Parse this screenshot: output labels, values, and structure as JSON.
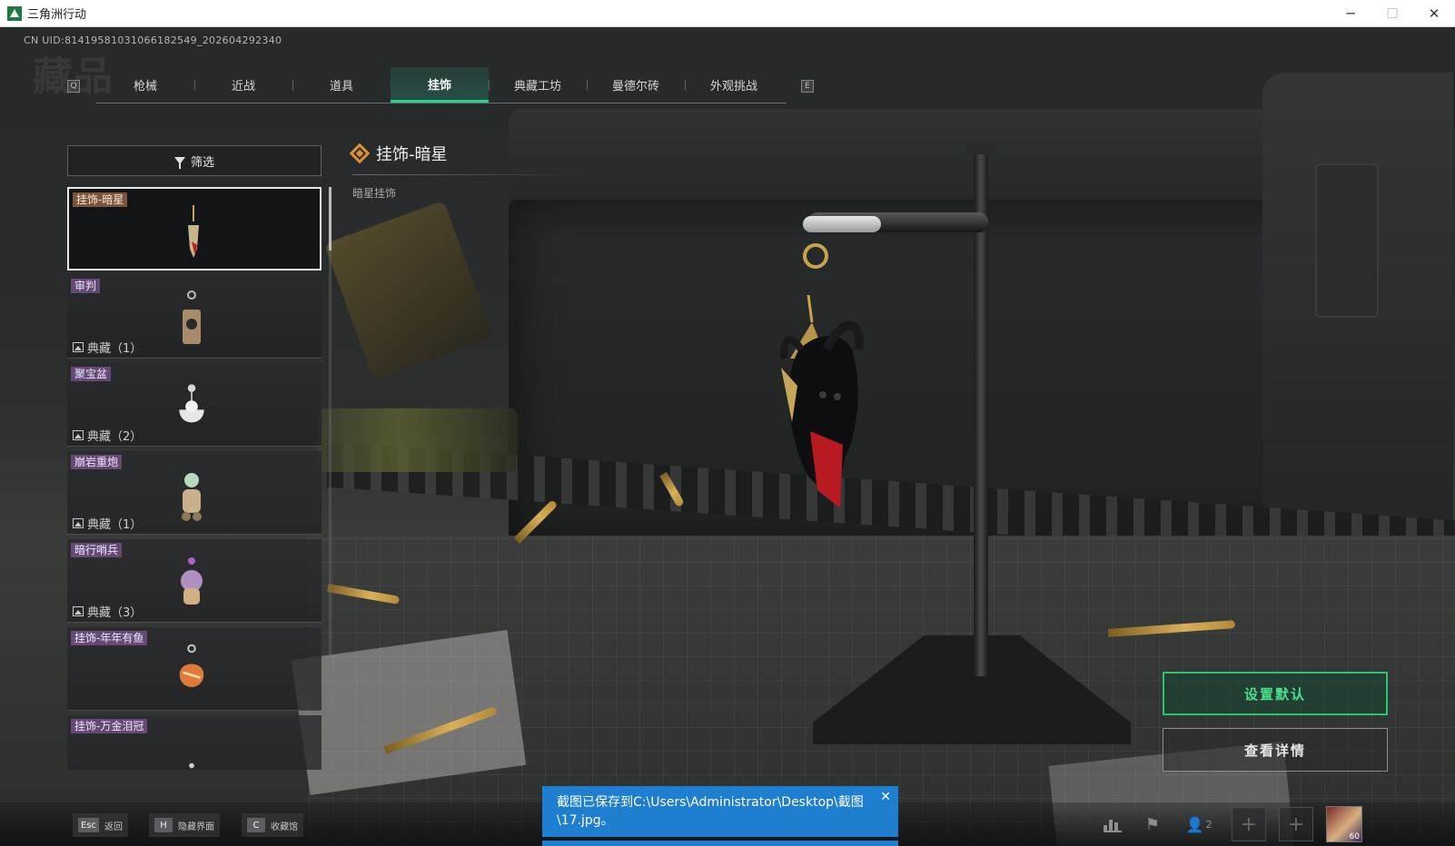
{
  "window": {
    "title": "三角洲行动",
    "minimize": "─",
    "maximize": "☐",
    "close": "✕"
  },
  "uid_text": "CN UID:8141958103106618254​9_202604292340",
  "tabs": [
    {
      "label": "枪械"
    },
    {
      "label": "近战"
    },
    {
      "label": "道具"
    },
    {
      "label": "挂饰"
    },
    {
      "label": "典藏工坊"
    },
    {
      "label": "曼德尔砖"
    },
    {
      "label": "外观挑战"
    }
  ],
  "tab_keys": {
    "prev": "Q",
    "next": "E"
  },
  "filter_label": "筛选",
  "items": [
    {
      "name": "挂饰-暗星",
      "count": ""
    },
    {
      "name": "审判",
      "count": "典藏（1）"
    },
    {
      "name": "聚宝盆",
      "count": "典藏（2）"
    },
    {
      "name": "崩岩重炮",
      "count": "典藏（1）"
    },
    {
      "name": "暗行哨兵",
      "count": "典藏（3）"
    },
    {
      "name": "挂饰-年年有鱼",
      "count": ""
    },
    {
      "name": "挂饰-万金泪冠",
      "count": ""
    }
  ],
  "detail": {
    "title": "挂饰-暗星",
    "description": "暗星挂饰"
  },
  "buttons": {
    "set_default": "设置默认",
    "view_details": "查看详情"
  },
  "bottom_hints": [
    {
      "key": "Esc",
      "label": "返回"
    },
    {
      "key": "H",
      "label": "隐藏界面"
    },
    {
      "key": "C",
      "label": "收藏馆"
    }
  ],
  "party": {
    "count": "2",
    "avatar_level": "60"
  },
  "toast": {
    "message": "截图已保存到C:\\Users\\Administrator\\Desktop\\截图\\17.jpg。",
    "close": "✕"
  },
  "colors": {
    "accent_green": "#2cc46f",
    "tab_active": "#27d28c",
    "toast_blue": "#1e7fd1",
    "rarity_purple": "#6e5082",
    "detail_icon_orange": "#e2902a"
  }
}
